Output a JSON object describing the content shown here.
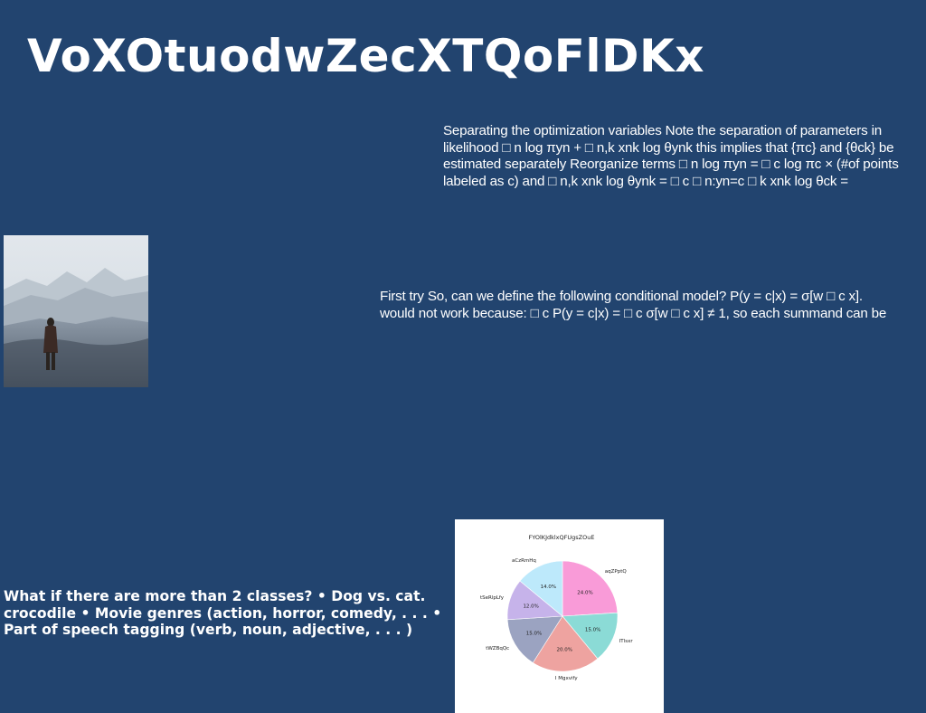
{
  "slide": {
    "title": "VoXOtuodwZecXTQoFlDKx"
  },
  "text_blocks": {
    "optimization": "Separating the optimization variables Note the separation of parameters in likelihood □ n log πyn + □ n,k xnk log θynk this implies that {πc} and {θck} be estimated separately Reorganize terms □ n log πyn = □ c log πc × (#of points labeled as c) and □ n,k xnk log θynk = □ c □ n:yn=c □ k xnk log θck =",
    "first_try_line1": "First try So, can we define the following conditional model? P(y = c|x) = σ[w □ c x].",
    "first_try_line2": "would not work because: □ c P(y = c|x) = □ c σ[w □ c x] ≠ 1, so each summand can be",
    "more_classes": "What if there are more than 2 classes? • Dog vs. cat. crocodile • Movie genres (action, horror, comedy, . . . • Part of speech tagging (verb, noun, adjective, . . . )"
  },
  "photo": {
    "description_icon": "mountain-landscape-photo"
  },
  "chart_data": {
    "type": "pie",
    "title": "FYOlKJdklxQFUgsZOuE",
    "slices": [
      {
        "label": "aqZPptQ",
        "value": 24.0,
        "display": "24.0%",
        "color": "#f99bd8"
      },
      {
        "label": "ITlsxr",
        "value": 15.0,
        "display": "15.0%",
        "color": "#8bdbd6"
      },
      {
        "label": "I Mgxvify",
        "value": 20.0,
        "display": "20.0%",
        "color": "#eea3a0"
      },
      {
        "label": "tWZBqQc",
        "value": 15.0,
        "display": "15.0%",
        "color": "#9ba3c1"
      },
      {
        "label": "tSeRlpLfy",
        "value": 12.0,
        "display": "12.0%",
        "color": "#c6b3ea"
      },
      {
        "label": "aCzRmHq",
        "value": 14.0,
        "display": "14.0%",
        "color": "#bde9fb"
      }
    ],
    "start_angle": "top",
    "direction": "clockwise"
  },
  "colors": {
    "background": "#22446f",
    "text": "#ffffff",
    "chart_background": "#ffffff"
  }
}
